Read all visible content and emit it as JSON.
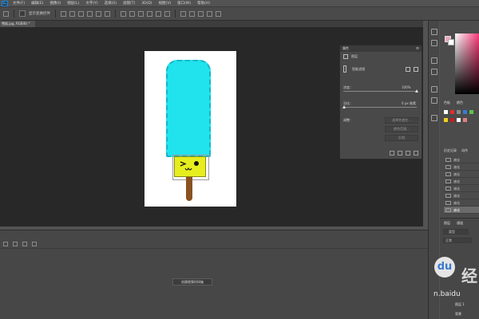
{
  "menubar": {
    "logo": "Ps",
    "items": [
      "文件(F)",
      "编辑(E)",
      "图像(I)",
      "图层(L)",
      "文字(Y)",
      "选择(S)",
      "滤镜(T)",
      "3D(D)",
      "视图(V)",
      "窗口(W)",
      "帮助(H)"
    ]
  },
  "options": {
    "auto_select_label": "显示变换控件"
  },
  "document": {
    "tab_title": "雪糕.jpg, RGB/8) *"
  },
  "properties": {
    "title": "属性",
    "layer_type": "图层",
    "smart_object": "智能滤镜",
    "opacity_label": "浓度：",
    "opacity_value": "100%",
    "feather_label": "羽化：",
    "feather_value": "0 px 像素",
    "adjust_label": "调整：",
    "btn1": "选择并遮住...",
    "btn2": "颜色范围...",
    "btn3": "反相"
  },
  "timeline": {
    "create_button": "创建视频时间轴"
  },
  "rightpanel": {
    "tabs": [
      "色板",
      "颜色"
    ],
    "history_tabs": [
      "历史记录",
      "动作"
    ],
    "history_items": [
      "液化",
      "液化",
      "液化",
      "液化",
      "液化",
      "液化",
      "液化",
      "液化"
    ],
    "layers_tabs": [
      "图层",
      "通道"
    ],
    "kind_label": "类型",
    "blend_label": "正常",
    "layer_names": [
      "图层 1",
      "背景"
    ]
  },
  "watermark": {
    "paw": "du",
    "brand": "经",
    "url": "n.baidu"
  },
  "colors": {
    "ice": "#20e3ee",
    "face": "#e6ee1e",
    "stick": "#8a5220",
    "foreground": "#f2a4bd"
  }
}
